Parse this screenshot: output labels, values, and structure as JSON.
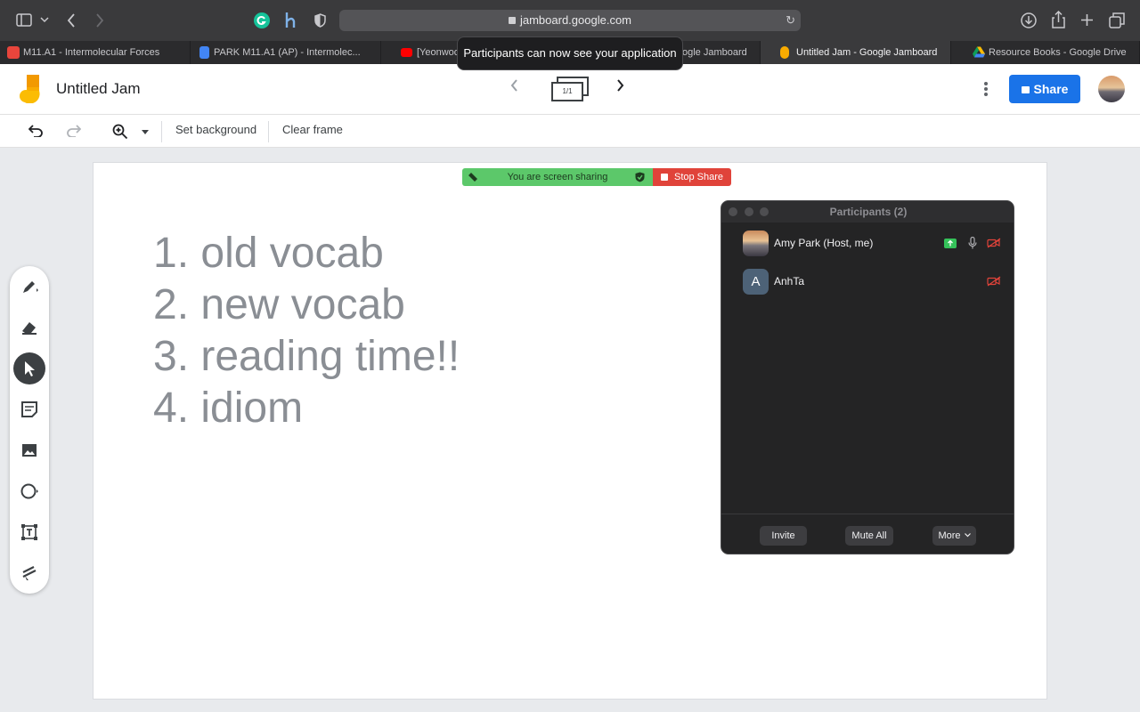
{
  "browser": {
    "url": "jamboard.google.com",
    "icons": [
      "sidebar-icon",
      "chevron-down-icon",
      "back-icon",
      "forward-icon",
      "grammarly-icon",
      "honey-icon",
      "shield-icon",
      "reload-icon",
      "download-icon",
      "share-icon",
      "new-tab-icon",
      "tabs-overview-icon"
    ]
  },
  "tabs": [
    {
      "title": "M11.A1 - Intermolecular Forces",
      "active": false
    },
    {
      "title": "PARK M11.A1 (AP) - Intermolec...",
      "active": false
    },
    {
      "title": "[Yeonwoo",
      "active": false
    },
    {
      "title": "ogle Jamboard",
      "active": false
    },
    {
      "title": "Untitled Jam - Google Jamboard",
      "active": true
    },
    {
      "title": "Resource Books - Google Drive",
      "active": false
    }
  ],
  "toast": "Participants can now see your application",
  "jam": {
    "title": "Untitled Jam",
    "frame_indicator": "1/1",
    "share_label": "Share",
    "toolbar": {
      "set_background": "Set background",
      "clear_frame": "Clear frame"
    },
    "agenda": [
      "1. old vocab",
      "2. new vocab",
      "3. reading time!!",
      "4. idiom"
    ],
    "tools": [
      "pen-icon",
      "eraser-icon",
      "select-icon",
      "sticky-note-icon",
      "image-icon",
      "shape-icon",
      "text-box-icon",
      "laser-icon"
    ],
    "selected_tool": "select-icon"
  },
  "screen_share": {
    "status": "You are screen sharing",
    "stop_label": "Stop Share"
  },
  "participants": {
    "title": "Participants (2)",
    "list": [
      {
        "name": "Amy Park (Host, me)",
        "initial": ""
      },
      {
        "name": "AnhTa",
        "initial": "A"
      }
    ],
    "buttons": {
      "invite": "Invite",
      "mute_all": "Mute All",
      "more": "More"
    }
  },
  "colors": {
    "accent_blue": "#1a73e8",
    "share_green": "#5cc86a",
    "stop_red": "#e0433a",
    "agenda_text": "#8a8e94"
  }
}
